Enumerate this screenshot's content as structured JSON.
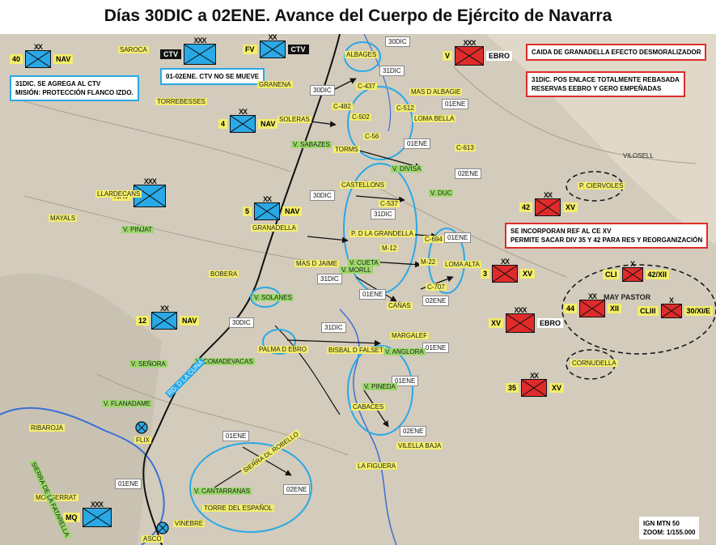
{
  "title": "Días 30DIC a 02ENE. Avance del Cuerpo de Ejército de Navarra",
  "colors": {
    "nationalist": "#29a9e6",
    "republican": "#e02b2b",
    "town_label": "#f4ee6a",
    "village_label": "#9cd86b"
  },
  "units": [
    {
      "id": "40nav",
      "number": "40",
      "name": "NAV",
      "side": "blue",
      "echelon": "XX"
    },
    {
      "id": "ctv1",
      "prefix": "CTV",
      "side": "blue",
      "echelon": "XXX"
    },
    {
      "id": "fv",
      "prefix": "FV",
      "suffix": "CTV",
      "side": "blue",
      "echelon": "XX"
    },
    {
      "id": "4nav",
      "number": "4",
      "name": "NAV",
      "side": "blue",
      "echelon": "XX"
    },
    {
      "id": "nav",
      "name": "NAV",
      "side": "blue",
      "echelon": "XXX"
    },
    {
      "id": "5nav",
      "number": "5",
      "name": "NAV",
      "side": "blue",
      "echelon": "XX"
    },
    {
      "id": "12nav",
      "number": "12",
      "name": "NAV",
      "side": "blue",
      "echelon": "XX"
    },
    {
      "id": "mq",
      "name": "MQ",
      "side": "blue",
      "echelon": "XXX"
    },
    {
      "id": "vebro",
      "number": "V",
      "name": "EBRO",
      "side": "red",
      "echelon": "XXX"
    },
    {
      "id": "42xv",
      "number": "42",
      "name": "XV",
      "side": "red",
      "echelon": "XX"
    },
    {
      "id": "3xv",
      "number": "3",
      "name": "XV",
      "side": "red",
      "echelon": "XX"
    },
    {
      "id": "cli",
      "number": "CLI",
      "name": "42/XII",
      "side": "red",
      "echelon": "X"
    },
    {
      "id": "44xii",
      "number": "44",
      "name": "XII",
      "side": "red",
      "echelon": "XX"
    },
    {
      "id": "clii",
      "number": "CLIII",
      "name": "30/XI/E",
      "side": "red",
      "echelon": "X"
    },
    {
      "id": "xvebro",
      "number": "XV",
      "name": "EBRO",
      "side": "red",
      "echelon": "XXX"
    },
    {
      "id": "35xv",
      "number": "35",
      "name": "XV",
      "side": "red",
      "echelon": "XX"
    }
  ],
  "notes": {
    "n1": "31DIC. SE AGREGA AL CTV\nMISIÓN: PROTECCIÓN FLANCO IZDO.",
    "n2": "01-02ENE. CTV NO SE MUEVE",
    "n3": "CAIDA DE GRANADELLA EFECTO DESMORALIZADOR",
    "n4": "31DIC. POS ENLACE TOTALMENTE REBASADA\nRESERVAS EEBRO Y GERO EMPEÑADAS",
    "n5": "SE INCORPORAN REF AL CE XV\nPERMITE SACAR DIV 35 Y 42 PARA RES Y REORGANIZACIÓN",
    "scale": "IGN MTN 50\nZOOM: 1/155.000"
  },
  "dates": [
    "30DIC",
    "31DIC",
    "30DIC",
    "01ENE",
    "01ENE",
    "02ENE",
    "30DIC",
    "31DIC",
    "01ENE",
    "31DIC",
    "01ENE",
    "02ENE",
    "30DIC",
    "31DIC",
    "01ENE",
    "01ENE",
    "02ENE",
    "01ENE",
    "01ENE",
    "02ENE"
  ],
  "towns": [
    "SAROCA",
    "ALBAGES",
    "GRANENA",
    "TORREBESSES",
    "SOLERAS",
    "V. SABAZES",
    "TORMS",
    "MAS D ALBAGIE",
    "LOMA BELLA",
    "LLARDECANS",
    "MAYALS",
    "V. PINJAT",
    "GRANADELLA",
    "CASTELLONS",
    "P. D LA GRANDELLA",
    "BOBERA",
    "MAS D JAIME",
    "LOMA ALTA",
    "V. SOLANES",
    "CAÑAS",
    "PALMA D EBRO",
    "BISBAL D FALSET",
    "MARGALEF",
    "V. ANGLORA",
    "V. PINEDA",
    "CABACES",
    "VILELLA BAJA",
    "LA FIGUERA",
    "V. CANTARRANAS",
    "TORRE DEL ESPAÑOL",
    "VINEBRE",
    "ASCO",
    "RIBAROJA",
    "V. FLANADAME",
    "MONSERRAT",
    "VILOSELL",
    "P. CIERVOLES",
    "MAY PASTOR",
    "CORNUDELLA",
    "V. DIVISA",
    "V. DUC",
    "V. SEÑORA",
    "V. COMADEVACAS",
    "V. CUETA",
    "V. MORLL",
    "FLIX",
    "C-437",
    "C-482",
    "C-512",
    "C-502",
    "C-56",
    "C-613",
    "C-537",
    "C-694",
    "M-12",
    "M-22",
    "C-707",
    "RD. D LA CUNA",
    "SIERRA DL ROBELLO",
    "SIERRA DE LA FATARELLA",
    "FV"
  ],
  "towns_pos_keys": "see markup"
}
